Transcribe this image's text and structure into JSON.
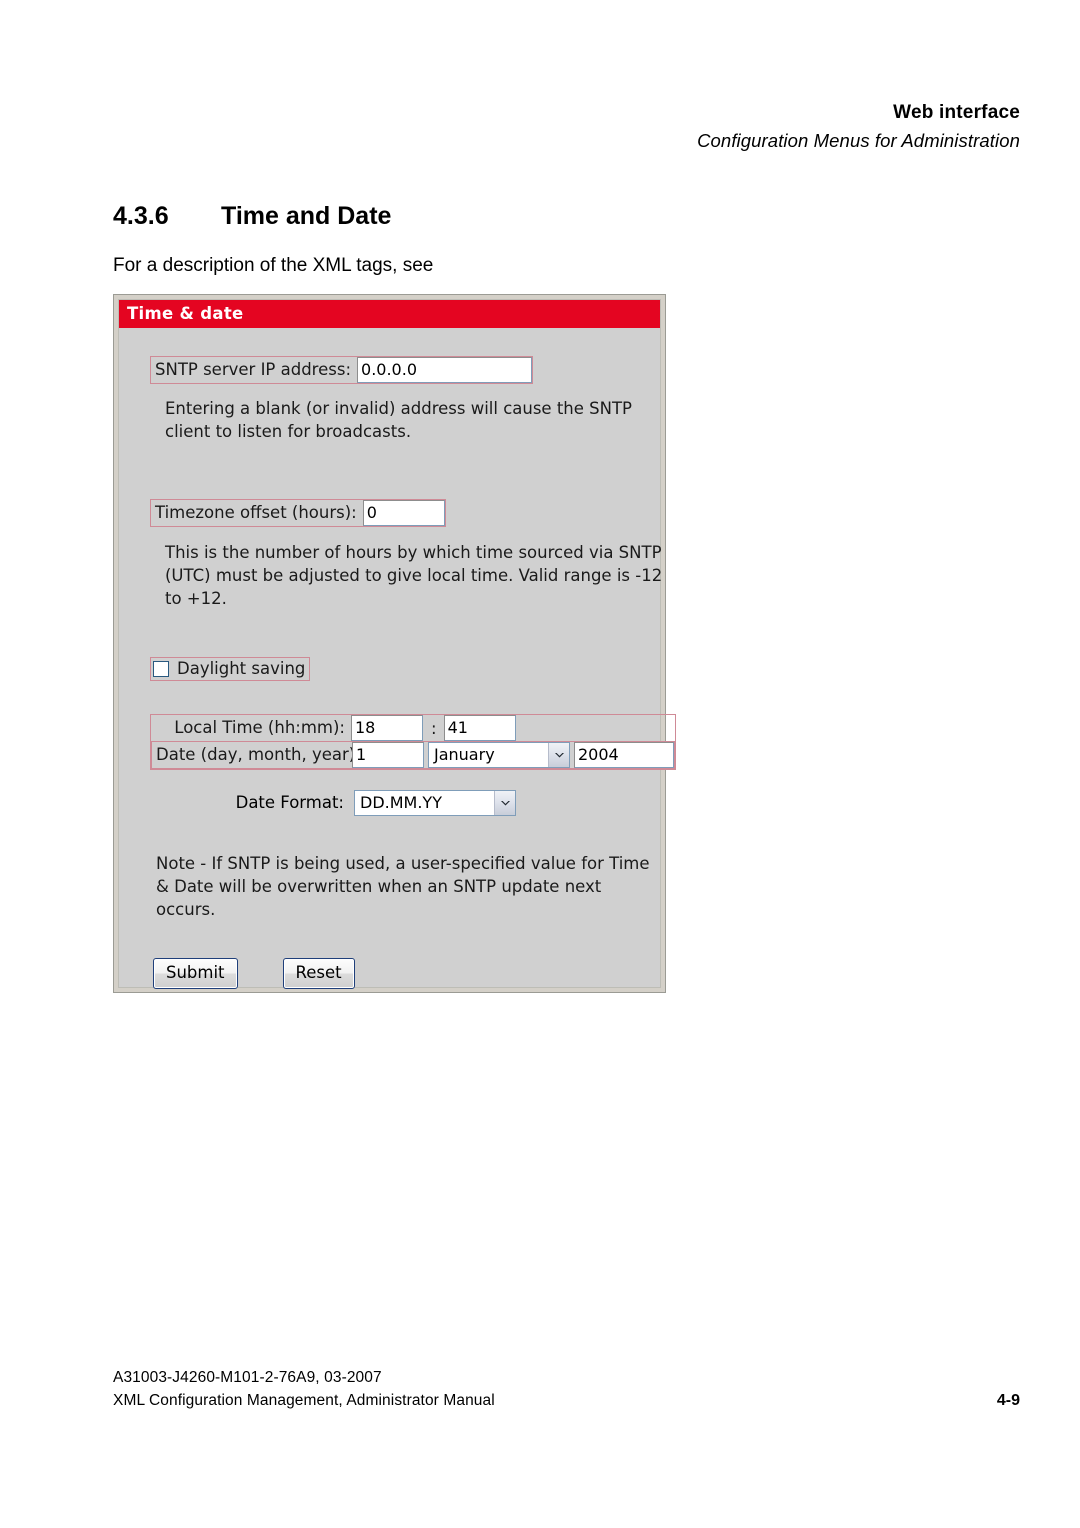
{
  "header": {
    "title": "Web interface",
    "subtitle": "Configuration Menus for Administration"
  },
  "section": {
    "number": "4.3.6",
    "title": "Time and Date",
    "intro": "For a description of the XML tags, see"
  },
  "panel": {
    "titlebar": "Time & date",
    "sntp": {
      "label": "SNTP server IP address:",
      "value": "0.0.0.0",
      "help": "Entering a blank (or invalid) address will cause the SNTP client to listen for broadcasts."
    },
    "timezone": {
      "label": "Timezone offset (hours):",
      "value": "0",
      "help": "This is the number of hours by which time sourced via SNTP (UTC) must be adjusted to give local time. Valid range is -12 to +12."
    },
    "daylight": {
      "label": "Daylight saving",
      "checked": false
    },
    "local_time": {
      "label": "Local Time (hh:mm):",
      "hours": "18",
      "separator": ":",
      "minutes": "41"
    },
    "date": {
      "label": "Date (day, month, year):",
      "day": "1",
      "month": "January",
      "year": "2004"
    },
    "date_format": {
      "label": "Date Format:",
      "value": "DD.MM.YY"
    },
    "note": "Note - If SNTP is being used, a user-specified value for Time & Date will be overwritten when an SNTP update next occurs.",
    "buttons": {
      "submit": "Submit",
      "reset": "Reset"
    },
    "colors": {
      "titlebar_red": "#e40521",
      "panel_grey": "#d0d0d0",
      "field_outline_pink": "#cf8a96",
      "input_border_blue": "#7f9db9",
      "button_border_navy": "#1f3f7a"
    }
  },
  "footer": {
    "doc_id": "A31003-J4260-M101-2-76A9, 03-2007",
    "doc_title": "XML Configuration Management, Administrator Manual",
    "page": "4-9"
  }
}
